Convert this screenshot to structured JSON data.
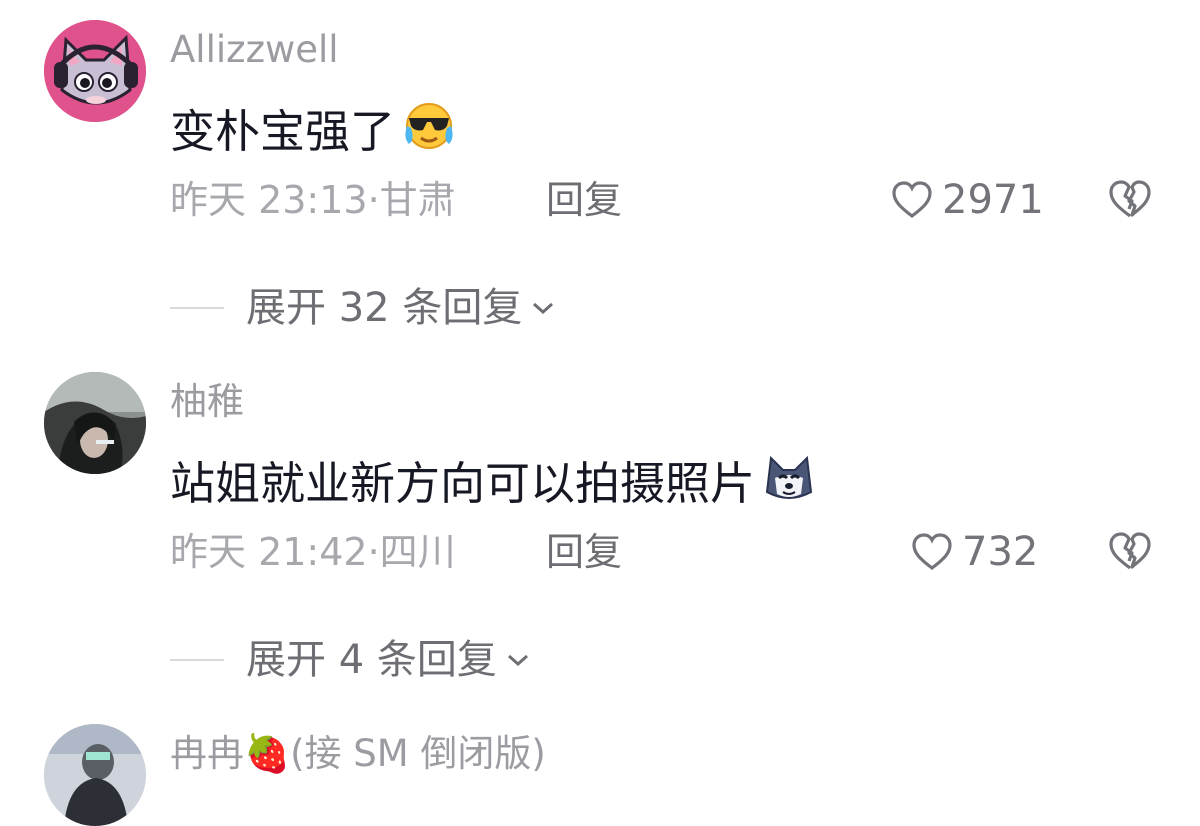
{
  "comments": [
    {
      "username": "Allizzwell",
      "text": "变朴宝强了",
      "emoji_icon": "cool-crying-emoji-icon",
      "meta": "昨天 23:13·甘肃",
      "reply_label": "回复",
      "likes": "2971",
      "expand_label": "展开 32 条回复"
    },
    {
      "username": "柚稚",
      "text": "站姐就业新方向可以拍摄照片",
      "emoji_icon": "husky-dog-emoji-icon",
      "meta": "昨天 21:42·四川",
      "reply_label": "回复",
      "likes": "732",
      "expand_label": "展开 4 条回复"
    },
    {
      "username": "冉冉🍓(接 SM 倒闭版)"
    }
  ],
  "colors": {
    "text_primary": "#161823",
    "text_secondary": "#a7a8ad",
    "text_action": "#6d6e73"
  }
}
